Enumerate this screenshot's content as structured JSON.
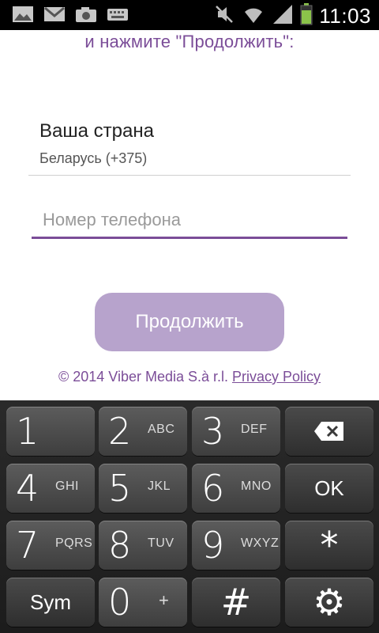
{
  "status_bar": {
    "icons": [
      "gallery-icon",
      "gmail-icon",
      "camera-icon",
      "keyboard-icon",
      "mute-icon",
      "wifi-icon",
      "signal-icon",
      "battery-icon"
    ],
    "time": "11:03"
  },
  "content": {
    "instruction": "и нажмите \"Продолжить\":",
    "country_title": "Ваша страна",
    "country_value": "Беларусь (+375)",
    "phone_placeholder": "Номер телефона",
    "phone_value": "",
    "continue_label": "Продолжить",
    "copyright_text": "© 2014 Viber Media S.à r.l. ",
    "privacy_link": "Privacy Policy"
  },
  "keyboard": {
    "keys": [
      {
        "num": "1",
        "letters": ""
      },
      {
        "num": "2",
        "letters": "ABC"
      },
      {
        "num": "3",
        "letters": "DEF"
      },
      {
        "label": "⌫"
      },
      {
        "num": "4",
        "letters": "GHI"
      },
      {
        "num": "5",
        "letters": "JKL"
      },
      {
        "num": "6",
        "letters": "MNO"
      },
      {
        "label": "OK"
      },
      {
        "num": "7",
        "letters": "PQRS"
      },
      {
        "num": "8",
        "letters": "TUV"
      },
      {
        "num": "9",
        "letters": "WXYZ"
      },
      {
        "label": "*"
      },
      {
        "label": "Sym"
      },
      {
        "num": "0",
        "plus": "+"
      },
      {
        "label": "#"
      },
      {
        "label": "⚙"
      }
    ]
  },
  "colors": {
    "accent": "#7b4d98",
    "button": "#b7a3cc"
  }
}
